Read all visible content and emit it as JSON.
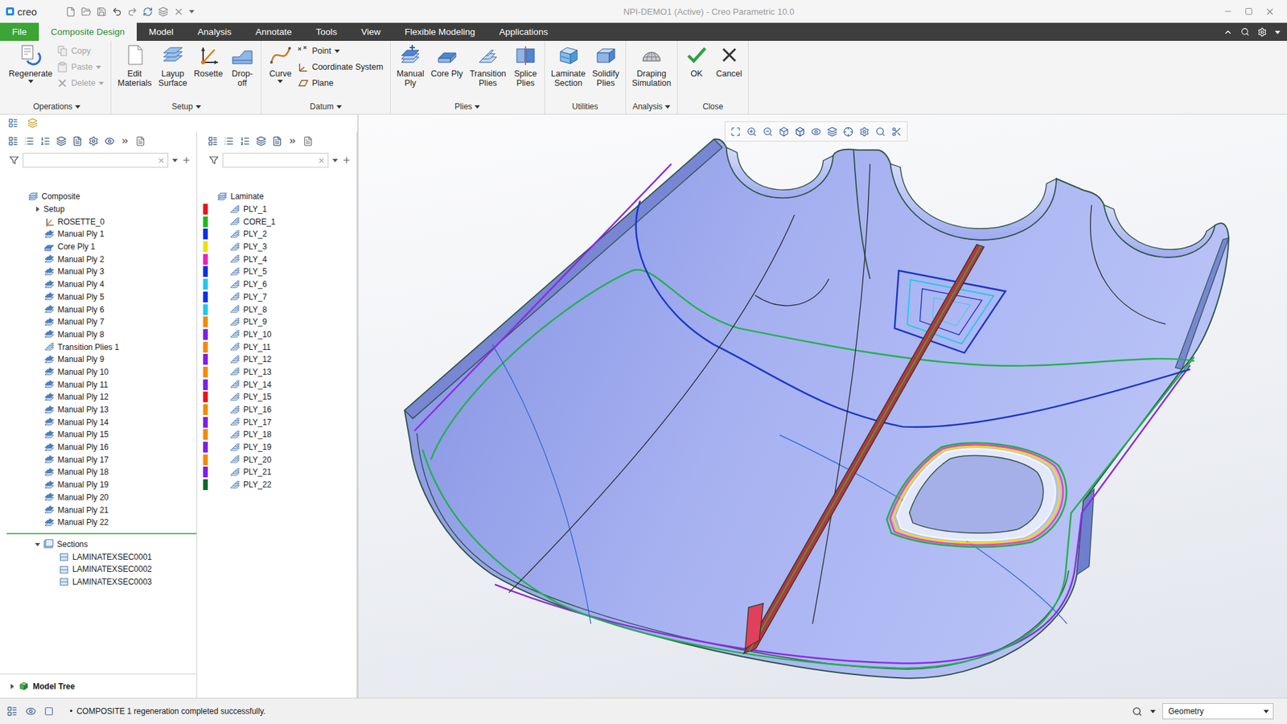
{
  "window": {
    "logo": "creo",
    "title": "NPI-DEMO1 (Active) - Creo Parametric 10.0"
  },
  "tabs": [
    {
      "label": "File",
      "selected": false,
      "kind": "file"
    },
    {
      "label": "Composite Design",
      "selected": true,
      "kind": "tab"
    },
    {
      "label": "Model",
      "selected": false,
      "kind": "tab"
    },
    {
      "label": "Analysis",
      "selected": false,
      "kind": "tab"
    },
    {
      "label": "Annotate",
      "selected": false,
      "kind": "tab"
    },
    {
      "label": "Tools",
      "selected": false,
      "kind": "tab"
    },
    {
      "label": "View",
      "selected": false,
      "kind": "tab"
    },
    {
      "label": "Flexible Modeling",
      "selected": false,
      "kind": "tab"
    },
    {
      "label": "Applications",
      "selected": false,
      "kind": "tab"
    }
  ],
  "ribbon": {
    "groups": [
      {
        "label": "Operations",
        "dropdown": true,
        "buttons": [
          {
            "label": "Regenerate",
            "kind": "large",
            "dropdown": true,
            "disabled": false
          },
          {
            "label": "Copy",
            "kind": "small",
            "dropdown": false,
            "disabled": true
          },
          {
            "label": "Paste",
            "kind": "small",
            "dropdown": true,
            "disabled": true
          },
          {
            "label": "Delete",
            "kind": "small",
            "dropdown": true,
            "disabled": true
          }
        ]
      },
      {
        "label": "Setup",
        "dropdown": true,
        "buttons": [
          {
            "label": "Edit\nMaterials",
            "kind": "large",
            "dropdown": false,
            "disabled": false
          },
          {
            "label": "Layup\nSurface",
            "kind": "large",
            "dropdown": false,
            "disabled": false
          },
          {
            "label": "Rosette",
            "kind": "large",
            "dropdown": false,
            "disabled": false
          },
          {
            "label": "Drop-\noff",
            "kind": "large",
            "dropdown": false,
            "disabled": false
          }
        ]
      },
      {
        "label": "Datum",
        "dropdown": true,
        "buttons": [
          {
            "label": "Curve",
            "kind": "large",
            "dropdown": true,
            "disabled": false
          },
          {
            "label": "Point",
            "kind": "small",
            "dropdown": true,
            "disabled": false
          },
          {
            "label": "Coordinate System",
            "kind": "small",
            "dropdown": false,
            "disabled": false
          },
          {
            "label": "Plane",
            "kind": "small",
            "dropdown": false,
            "disabled": false
          }
        ]
      },
      {
        "label": "Plies",
        "dropdown": true,
        "buttons": [
          {
            "label": "Manual\nPly",
            "kind": "large",
            "dropdown": false,
            "disabled": false
          },
          {
            "label": "Core Ply",
            "kind": "large",
            "dropdown": false,
            "disabled": false
          },
          {
            "label": "Transition\nPlies",
            "kind": "large",
            "dropdown": false,
            "disabled": false
          },
          {
            "label": "Splice\nPlies",
            "kind": "large",
            "dropdown": false,
            "disabled": false
          }
        ]
      },
      {
        "label": "Utilities",
        "dropdown": false,
        "buttons": [
          {
            "label": "Laminate\nSection",
            "kind": "large",
            "dropdown": false,
            "disabled": false
          },
          {
            "label": "Solidify\nPlies",
            "kind": "large",
            "dropdown": false,
            "disabled": false
          }
        ]
      },
      {
        "label": "Analysis",
        "dropdown": true,
        "buttons": [
          {
            "label": "Draping\nSimulation",
            "kind": "large",
            "dropdown": false,
            "disabled": false
          }
        ]
      },
      {
        "label": "Close",
        "dropdown": false,
        "buttons": [
          {
            "label": "OK",
            "kind": "large",
            "dropdown": false,
            "disabled": false
          },
          {
            "label": "Cancel",
            "kind": "large",
            "dropdown": false,
            "disabled": false
          }
        ]
      }
    ]
  },
  "composite_tree": {
    "root": "Composite",
    "items": [
      {
        "label": "Setup",
        "kind": "folder",
        "expanded": false
      },
      {
        "label": "ROSETTE_0",
        "kind": "rosette",
        "expanded": false
      },
      {
        "label": "Manual Ply 1",
        "kind": "ply",
        "expanded": false
      },
      {
        "label": "Core Ply 1",
        "kind": "core",
        "expanded": false
      },
      {
        "label": "Manual Ply 2",
        "kind": "ply",
        "expanded": false
      },
      {
        "label": "Manual Ply 3",
        "kind": "ply",
        "expanded": false
      },
      {
        "label": "Manual Ply 4",
        "kind": "ply",
        "expanded": false
      },
      {
        "label": "Manual Ply 5",
        "kind": "ply",
        "expanded": false
      },
      {
        "label": "Manual Ply 6",
        "kind": "ply",
        "expanded": false
      },
      {
        "label": "Manual Ply 7",
        "kind": "ply",
        "expanded": false
      },
      {
        "label": "Manual Ply 8",
        "kind": "ply",
        "expanded": false
      },
      {
        "label": "Transition Plies 1",
        "kind": "transition",
        "expanded": false
      },
      {
        "label": "Manual Ply 9",
        "kind": "ply",
        "expanded": false
      },
      {
        "label": "Manual Ply 10",
        "kind": "ply",
        "expanded": false
      },
      {
        "label": "Manual Ply 11",
        "kind": "ply",
        "expanded": false
      },
      {
        "label": "Manual Ply 12",
        "kind": "ply",
        "expanded": false
      },
      {
        "label": "Manual Ply 13",
        "kind": "ply",
        "expanded": false
      },
      {
        "label": "Manual Ply 14",
        "kind": "ply",
        "expanded": false
      },
      {
        "label": "Manual Ply 15",
        "kind": "ply",
        "expanded": false
      },
      {
        "label": "Manual Ply 16",
        "kind": "ply",
        "expanded": false
      },
      {
        "label": "Manual Ply 17",
        "kind": "ply",
        "expanded": false
      },
      {
        "label": "Manual Ply 18",
        "kind": "ply",
        "expanded": false
      },
      {
        "label": "Manual Ply 19",
        "kind": "ply",
        "expanded": false
      },
      {
        "label": "Manual Ply 20",
        "kind": "ply",
        "expanded": false
      },
      {
        "label": "Manual Ply 21",
        "kind": "ply",
        "expanded": false
      },
      {
        "label": "Manual Ply 22",
        "kind": "ply",
        "expanded": false
      }
    ],
    "sections": {
      "label": "Sections",
      "expanded": true,
      "items": [
        "LAMINATEXSEC0001",
        "LAMINATEXSEC0002",
        "LAMINATEXSEC0003"
      ]
    },
    "footer": {
      "label": "Model Tree",
      "expanded": false
    }
  },
  "laminate_tree": {
    "root": "Laminate",
    "plies": [
      {
        "label": "PLY_1",
        "color": "#e8141c"
      },
      {
        "label": "CORE_1",
        "color": "#1fb81f"
      },
      {
        "label": "PLY_2",
        "color": "#1030e0"
      },
      {
        "label": "PLY_3",
        "color": "#f0e000"
      },
      {
        "label": "PLY_4",
        "color": "#f020c0"
      },
      {
        "label": "PLY_5",
        "color": "#1030e0"
      },
      {
        "label": "PLY_6",
        "color": "#20c8f0"
      },
      {
        "label": "PLY_7",
        "color": "#1030e0"
      },
      {
        "label": "PLY_8",
        "color": "#20c8f0"
      },
      {
        "label": "PLY_9",
        "color": "#f08c00"
      },
      {
        "label": "PLY_10",
        "color": "#8020e0"
      },
      {
        "label": "PLY_11",
        "color": "#f08c00"
      },
      {
        "label": "PLY_12",
        "color": "#8020e0"
      },
      {
        "label": "PLY_13",
        "color": "#f08c00"
      },
      {
        "label": "PLY_14",
        "color": "#8020e0"
      },
      {
        "label": "PLY_15",
        "color": "#e8141c"
      },
      {
        "label": "PLY_16",
        "color": "#f08c00"
      },
      {
        "label": "PLY_17",
        "color": "#8020e0"
      },
      {
        "label": "PLY_18",
        "color": "#f08c00"
      },
      {
        "label": "PLY_19",
        "color": "#8020e0"
      },
      {
        "label": "PLY_20",
        "color": "#f08c00"
      },
      {
        "label": "PLY_21",
        "color": "#8020e0"
      },
      {
        "label": "PLY_22",
        "color": "#0a6a2a"
      }
    ]
  },
  "status_bar": {
    "bullet": "•",
    "message": "COMPOSITE 1 regeneration completed successfully.",
    "selection_filter": "Geometry"
  }
}
